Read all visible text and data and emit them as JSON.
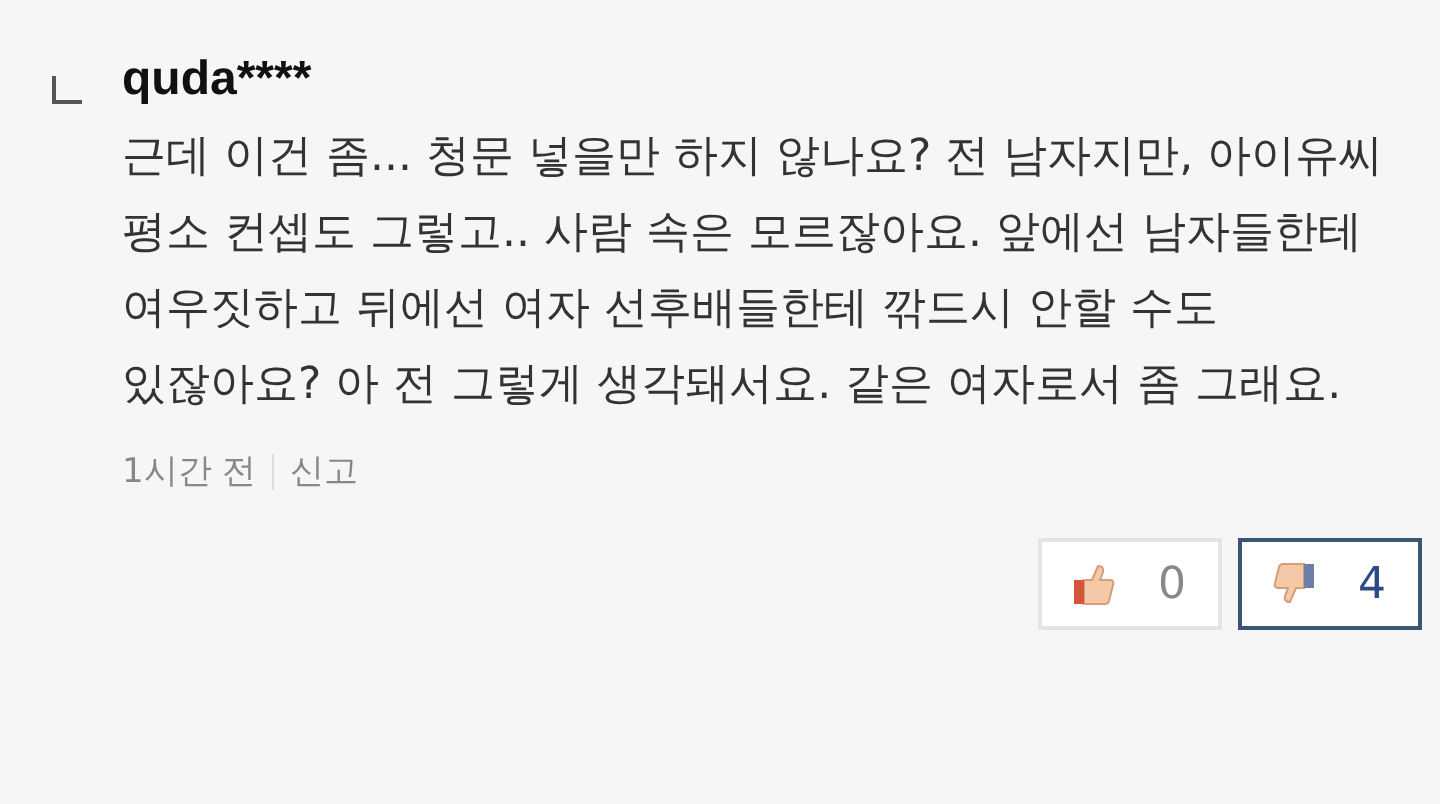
{
  "comment": {
    "author": "quda****",
    "text": "근데 이건 좀... 청문 넣을만 하지 않나요? 전 남자지만, 아이유씨 평소 컨셉도 그렇고.. 사람 속은 모르잖아요. 앞에선 남자들한테 여우짓하고 뒤에선 여자 선후배들한테 깎드시 안할 수도 있잖아요? 아 전 그렇게 생각돼서요. 같은 여자로서 좀 그래요.",
    "time": "1시간 전",
    "report": "신고",
    "votes": [
      {
        "kind": "up",
        "count": "0",
        "selected": false
      },
      {
        "kind": "down",
        "count": "4",
        "selected": true
      }
    ]
  }
}
